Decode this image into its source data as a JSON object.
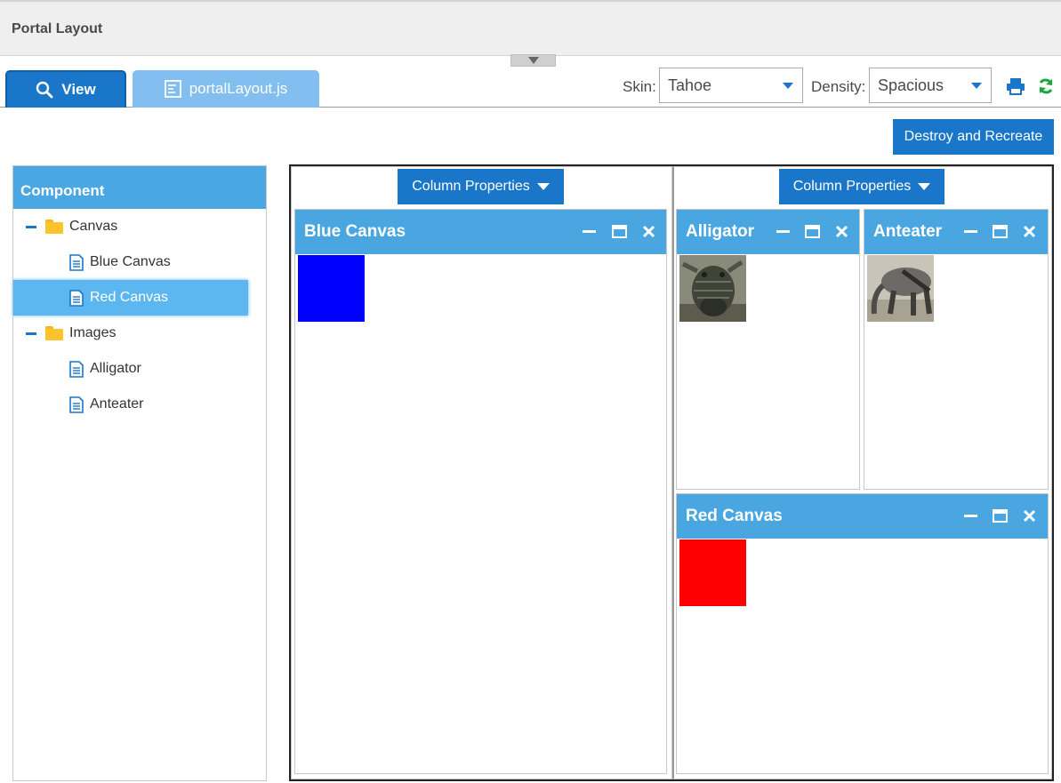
{
  "window": {
    "title": "Portal Layout"
  },
  "tabs": [
    {
      "label": "View",
      "icon": "search-icon"
    },
    {
      "label": "portalLayout.js",
      "icon": "code-file-icon"
    }
  ],
  "toolbar": {
    "skin_label": "Skin:",
    "skin_value": "Tahoe",
    "density_label": "Density:",
    "density_value": "Spacious",
    "print_icon": "print-icon",
    "refresh_icon": "refresh-icon"
  },
  "actions": {
    "destroy_recreate_label": "Destroy and Recreate"
  },
  "tree": {
    "header": "Component",
    "items": [
      {
        "label": "Canvas",
        "type": "folder"
      },
      {
        "label": "Blue Canvas",
        "type": "doc"
      },
      {
        "label": "Red Canvas",
        "type": "doc",
        "selected": true
      },
      {
        "label": "Images",
        "type": "folder"
      },
      {
        "label": "Alligator",
        "type": "doc"
      },
      {
        "label": "Anteater",
        "type": "doc"
      }
    ]
  },
  "portal": {
    "columns": [
      {
        "props_label": "Column Properties"
      },
      {
        "props_label": "Column Properties"
      }
    ],
    "portlets": {
      "blue": {
        "title": "Blue Canvas",
        "color": "#0000ff"
      },
      "alligator": {
        "title": "Alligator"
      },
      "anteater": {
        "title": "Anteater"
      },
      "red": {
        "title": "Red Canvas",
        "color": "#ff0000"
      }
    }
  },
  "colors": {
    "accent": "#1a76c9",
    "header": "#4aa6e1",
    "selected": "#5cb6ef"
  }
}
